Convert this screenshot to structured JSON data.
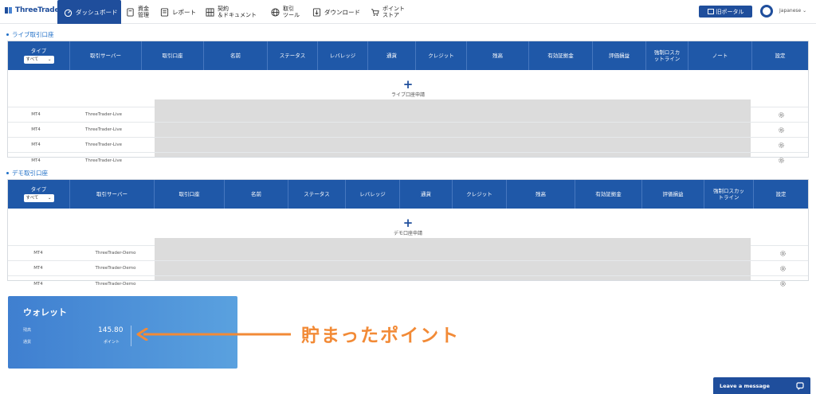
{
  "brand": {
    "name": "ThreeTrader"
  },
  "nav": [
    {
      "label": "ダッシュボード",
      "icon": "dashboard-icon",
      "active": true
    },
    {
      "label": "資金\n管理",
      "icon": "wallet-icon"
    },
    {
      "label": "レポート",
      "icon": "report-icon"
    },
    {
      "label": "契約\n＆ドキュメント",
      "icon": "document-icon"
    },
    {
      "label": "取引\nツール",
      "icon": "globe-icon"
    },
    {
      "label": "ダウンロード",
      "icon": "download-icon"
    },
    {
      "label": "ポイント\nストア",
      "icon": "cart-icon"
    }
  ],
  "header": {
    "old_portal": "旧ポータル",
    "language": "Japanese"
  },
  "live": {
    "title": "ライブ取引口座",
    "type_label": "タイプ",
    "type_value": "すべて",
    "columns": [
      "取引サーバー",
      "取引口座",
      "名前",
      "ステータス",
      "レバレッジ",
      "通貨",
      "クレジット",
      "残高",
      "有効証拠金",
      "評価損益",
      "強制ロスカ\nットライン",
      "ノート",
      "設定"
    ],
    "add_label": "ライブ口座申請",
    "rows": [
      {
        "platform": "MT4",
        "server": "ThreeTrader-Live"
      },
      {
        "platform": "MT4",
        "server": "ThreeTrader-Live"
      },
      {
        "platform": "MT4",
        "server": "ThreeTrader-Live"
      },
      {
        "platform": "MT4",
        "server": "ThreeTrader-Live"
      }
    ]
  },
  "demo": {
    "title": "デモ取引口座",
    "type_label": "タイプ",
    "type_value": "すべて",
    "columns": [
      "取引サーバー",
      "取引口座",
      "名前",
      "ステータス",
      "レバレッジ",
      "通貨",
      "クレジット",
      "残高",
      "有効証拠金",
      "評価損益",
      "強制ロスカッ\nトライン",
      "設定"
    ],
    "add_label": "デモ口座申請",
    "rows": [
      {
        "platform": "MT4",
        "server": "ThreeTrader-Demo"
      },
      {
        "platform": "MT4",
        "server": "ThreeTrader-Demo"
      },
      {
        "platform": "MT4",
        "server": "ThreeTrader-Demo"
      }
    ]
  },
  "wallet": {
    "title": "ウォレット",
    "label1": "残高",
    "label2": "通貨",
    "value": "145.80",
    "unit": "ポイント"
  },
  "annotation": {
    "text": "貯まったポイント",
    "color": "#f28a36"
  },
  "chat": {
    "label": "Leave a message"
  },
  "colors": {
    "primary": "#1f4e9c",
    "header": "#1f58a8",
    "accent": "#1f6fc7"
  }
}
